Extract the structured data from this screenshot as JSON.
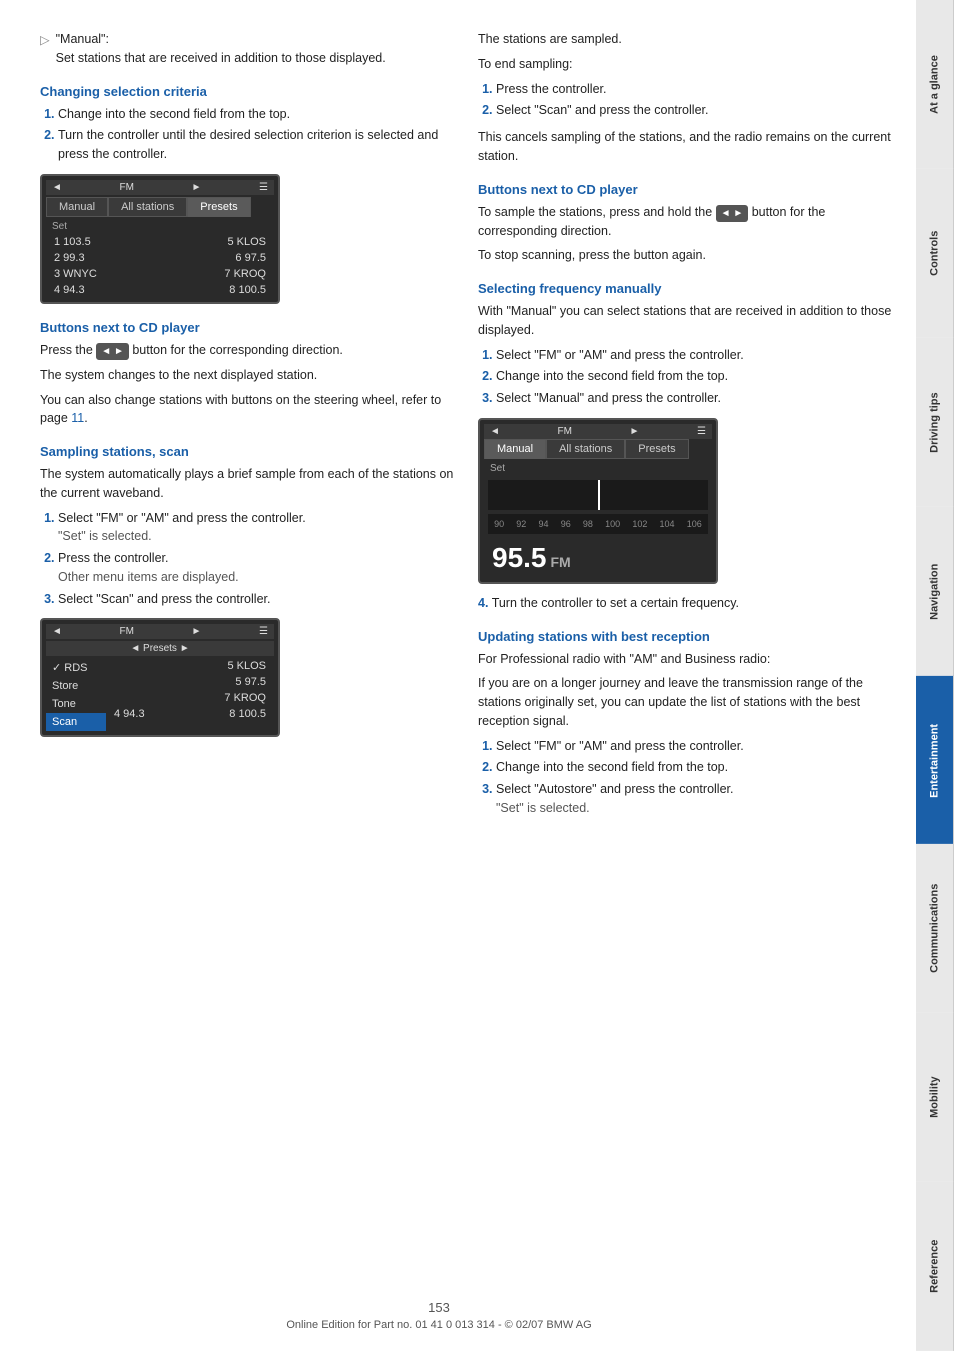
{
  "sidebar": {
    "tabs": [
      {
        "label": "At a glance",
        "active": false
      },
      {
        "label": "Controls",
        "active": false
      },
      {
        "label": "Driving tips",
        "active": false
      },
      {
        "label": "Navigation",
        "active": false
      },
      {
        "label": "Entertainment",
        "active": true
      },
      {
        "label": "Communications",
        "active": false
      },
      {
        "label": "Mobility",
        "active": false
      },
      {
        "label": "Reference",
        "active": false
      }
    ]
  },
  "left_col": {
    "manual_bullet": {
      "label": "\"Manual\":",
      "description": "Set stations that are received in addition to those displayed."
    },
    "section1": {
      "heading": "Changing selection criteria",
      "steps": [
        "Change into the second field from the top.",
        "Turn the controller until the desired selection criterion is selected and press the controller."
      ]
    },
    "device1": {
      "top_bar": "FM",
      "tabs": [
        "Manual",
        "All stations",
        "Presets"
      ],
      "selected_tab": "Presets",
      "label": "Set",
      "rows": [
        {
          "left": "1 103.5",
          "right": "5 KLOS"
        },
        {
          "left": "2 99.3",
          "right": "6 97.5"
        },
        {
          "left": "3 WNYC",
          "right": "7 KROQ"
        },
        {
          "left": "4 94.3",
          "right": "8 100.5"
        }
      ]
    },
    "section2": {
      "heading": "Buttons next to CD player",
      "para1": "Press the",
      "button_label": "◄ ►",
      "para1_cont": "button for the corresponding direction.",
      "para2": "The system changes to the next displayed station.",
      "para3": "You can also change stations with buttons on the steering wheel, refer to page",
      "page_ref": "11",
      "para3_cont": "."
    },
    "section3": {
      "heading": "Sampling stations, scan",
      "para1": "The system automatically plays a brief sample from each of the stations on the current waveband.",
      "steps": [
        {
          "text": "Select \"FM\" or \"AM\" and press the controller.",
          "sub": "\"Set\" is selected."
        },
        {
          "text": "Press the controller.",
          "sub": "Other menu items are displayed."
        },
        {
          "text": "Select \"Scan\" and press the controller.",
          "sub": ""
        }
      ]
    },
    "device2": {
      "top_bar": "FM",
      "presets_bar": "◄ Presets ►",
      "menu_items": [
        "✓ RDS",
        "Store",
        "Tone",
        "Scan"
      ],
      "highlighted": "Scan",
      "stations": [
        {
          "right": "5 KLOS"
        },
        {
          "right": "5 97.5"
        },
        {
          "right": "7 KROQ"
        },
        {
          "right": "8 100.5"
        }
      ],
      "bottom_row": {
        "left": "4 94.3",
        "right": "8 100.5"
      }
    }
  },
  "right_col": {
    "sampling_para": "The stations are sampled.",
    "to_end_para": "To end sampling:",
    "steps_end": [
      "Press the controller.",
      "Select \"Scan\" and press the controller."
    ],
    "cancel_para": "This cancels sampling of the stations, and the radio remains on the current station.",
    "section_cd": {
      "heading": "Buttons next to CD player",
      "para1": "To sample the stations, press and hold the",
      "button_label": "◄ ►",
      "para1_cont": "button for the corresponding direction.",
      "para2": "To stop scanning, press the button again."
    },
    "section_manual": {
      "heading": "Selecting frequency manually",
      "para1": "With \"Manual\" you can select stations that are received in addition to those displayed.",
      "steps": [
        "Select \"FM\" or \"AM\" and press the controller.",
        "Change into the second field from the top.",
        "Select \"Manual\" and press the controller."
      ]
    },
    "device3": {
      "top_bar": "FM",
      "tabs": [
        "Manual",
        "All stations",
        "Presets"
      ],
      "selected_tab": "Manual",
      "label": "Set",
      "freq_labels": [
        "90",
        "92",
        "94",
        "96",
        "98",
        "100",
        "102",
        "104",
        "106"
      ],
      "freq_display": "95.5",
      "freq_unit": "FM"
    },
    "step4": "Turn the controller to set a certain frequency.",
    "section_update": {
      "heading": "Updating stations with best reception",
      "para1": "For Professional radio with \"AM\" and Business radio:",
      "para2": "If you are on a longer journey and leave the transmission range of the stations originally set, you can update the list of stations with the best reception signal.",
      "steps": [
        "Select \"FM\" or \"AM\" and press the controller.",
        "Change into the second field from the top.",
        {
          "text": "Select \"Autostore\" and press the controller.",
          "sub": "\"Set\" is selected."
        }
      ]
    }
  },
  "footer": {
    "page_number": "153",
    "copyright": "Online Edition for Part no. 01 41 0 013 314 - © 02/07 BMW AG"
  }
}
